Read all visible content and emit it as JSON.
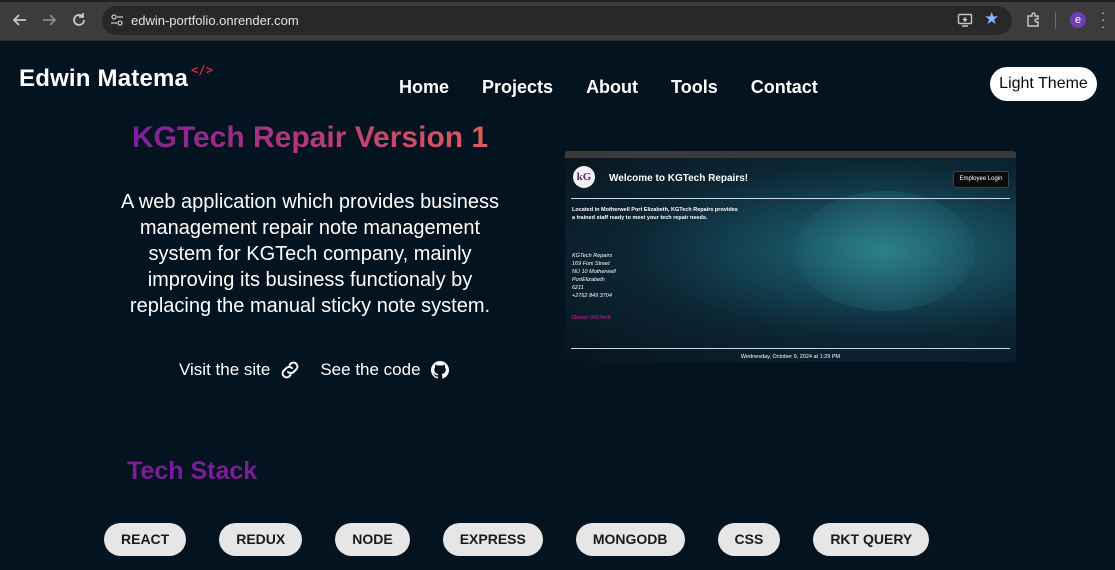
{
  "browser": {
    "url": "edwin-portfolio.onrender.com",
    "profile_initial": "e",
    "back_icon": "arrow-left-icon",
    "forward_icon": "arrow-right-icon",
    "reload_icon": "reload-icon"
  },
  "header": {
    "logo_text": "Edwin Matema",
    "logo_mark": "</>",
    "nav": [
      "Home",
      "Projects",
      "About",
      "Tools",
      "Contact"
    ],
    "theme_button": "Light Theme"
  },
  "project": {
    "title": "KGTech Repair Version 1",
    "description": "A web application which provides business management repair note management system for KGTech company, mainly improving its business functionaly by replacing the manual sticky note system.",
    "visit_label": "Visit the site",
    "code_label": "See the code"
  },
  "preview": {
    "logo": "kG",
    "heading": "Welcome to KGTech Repairs!",
    "login_button": "Employee Login",
    "intro": "Located in Motherwell Port Elizabeth, KGTech Repairs provides a trained staff ready to meet your tech repair needs.",
    "address": [
      "KGTech Repairs",
      "169 Foni Street",
      "NU 10 Motherwell",
      "PortElizabeth",
      "6211",
      "+2762 849 3704"
    ],
    "owner": "Owner: KGTech",
    "date": "Wednesday, October 9, 2024 at 1:29 PM"
  },
  "tech_stack": {
    "title": "Tech Stack",
    "items": [
      "REACT",
      "REDUX",
      "NODE",
      "EXPRESS",
      "MONGODB",
      "CSS",
      "RKT QUERY"
    ]
  },
  "colors": {
    "background": "#03131f",
    "title_gradient_start": "#7a1d9a",
    "title_gradient_end": "#e35d5b",
    "accent": "#e0283e"
  }
}
